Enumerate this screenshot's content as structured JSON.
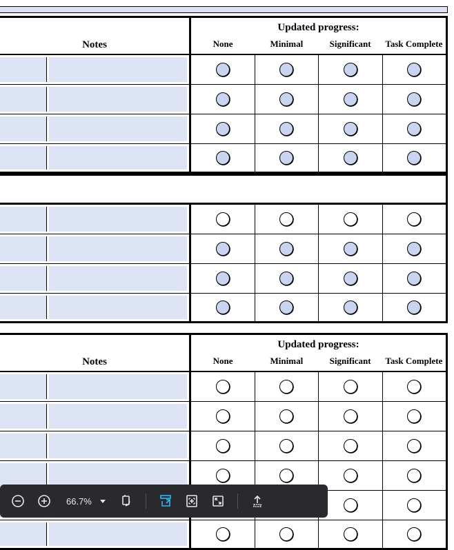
{
  "headers": {
    "notes": "Notes",
    "updated_progress": "Updated progress:",
    "none": "None",
    "minimal": "Minimal",
    "significant": "Significant",
    "task_complete": "Task Complete"
  },
  "section1": {
    "show_header": true,
    "rows": [
      {
        "filled": [
          true,
          true,
          true,
          true
        ]
      },
      {
        "filled": [
          true,
          true,
          true,
          true
        ]
      },
      {
        "filled": [
          true,
          true,
          true,
          true
        ]
      },
      {
        "filled": [
          true,
          true,
          true,
          true
        ]
      }
    ]
  },
  "section2": {
    "show_header": false,
    "rows": [
      {
        "filled": [
          false,
          false,
          false,
          false
        ]
      },
      {
        "filled": [
          true,
          true,
          true,
          true
        ]
      },
      {
        "filled": [
          true,
          true,
          true,
          true
        ]
      },
      {
        "filled": [
          true,
          true,
          true,
          true
        ]
      }
    ]
  },
  "section3": {
    "show_header": true,
    "rows": [
      {
        "filled": [
          false,
          false,
          false,
          false
        ]
      },
      {
        "filled": [
          false,
          false,
          false,
          false
        ]
      },
      {
        "filled": [
          false,
          false,
          false,
          false
        ]
      },
      {
        "filled": [
          false,
          false,
          false,
          false
        ]
      },
      {
        "filled": [
          false,
          false,
          false,
          false
        ]
      },
      {
        "filled": [
          false,
          false,
          false,
          false
        ]
      }
    ]
  },
  "toolbar": {
    "zoom": "66.7%"
  }
}
